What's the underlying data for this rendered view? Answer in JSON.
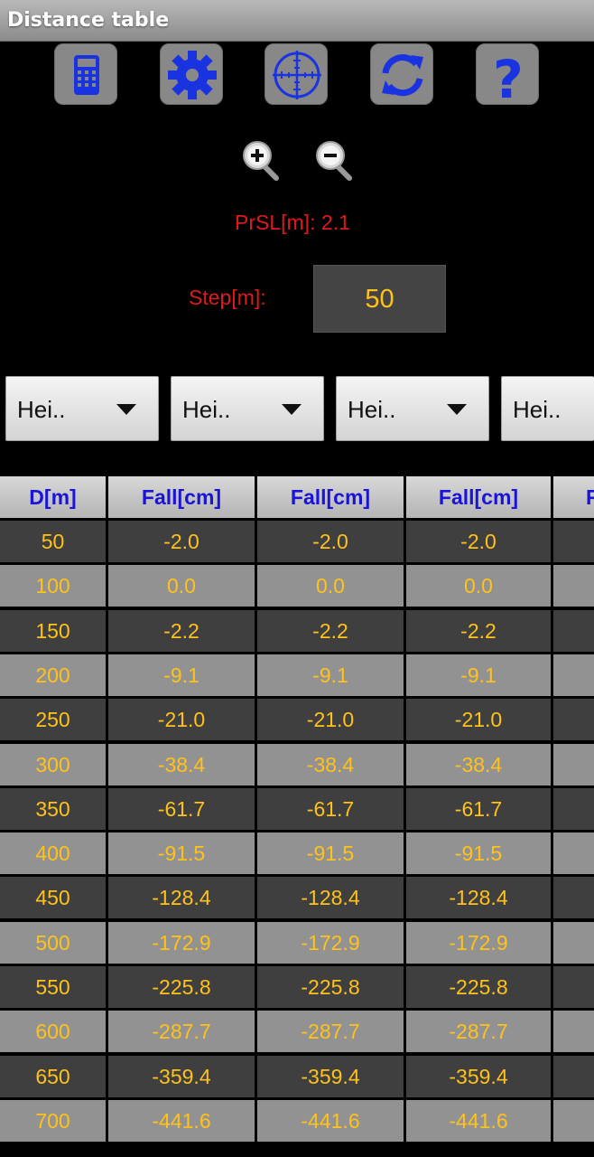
{
  "app": {
    "title": "Distance table"
  },
  "toolbar": [
    {
      "name": "calculator-icon"
    },
    {
      "name": "gear-icon"
    },
    {
      "name": "crosshair-icon"
    },
    {
      "name": "refresh-icon"
    },
    {
      "name": "help-icon",
      "glyph": "?"
    }
  ],
  "zoom": {
    "in_icon": "zoom-in-icon",
    "out_icon": "zoom-out-icon"
  },
  "info": {
    "prsl_label": "PrSL[m]: 2.1",
    "step_label": "Step[m]:",
    "step_value": "50"
  },
  "dropdowns": [
    {
      "label": "Hei.."
    },
    {
      "label": "Hei.."
    },
    {
      "label": "Hei.."
    },
    {
      "label": "Hei.."
    }
  ],
  "table": {
    "headers": [
      "D[m]",
      "Fall[cm]",
      "Fall[cm]",
      "Fall[cm]",
      "F"
    ],
    "rows": [
      [
        "50",
        "-2.0",
        "-2.0",
        "-2.0",
        ""
      ],
      [
        "100",
        "0.0",
        "0.0",
        "0.0",
        ""
      ],
      [
        "150",
        "-2.2",
        "-2.2",
        "-2.2",
        ""
      ],
      [
        "200",
        "-9.1",
        "-9.1",
        "-9.1",
        ""
      ],
      [
        "250",
        "-21.0",
        "-21.0",
        "-21.0",
        ""
      ],
      [
        "300",
        "-38.4",
        "-38.4",
        "-38.4",
        ""
      ],
      [
        "350",
        "-61.7",
        "-61.7",
        "-61.7",
        ""
      ],
      [
        "400",
        "-91.5",
        "-91.5",
        "-91.5",
        ""
      ],
      [
        "450",
        "-128.4",
        "-128.4",
        "-128.4",
        ""
      ],
      [
        "500",
        "-172.9",
        "-172.9",
        "-172.9",
        ""
      ],
      [
        "550",
        "-225.8",
        "-225.8",
        "-225.8",
        ""
      ],
      [
        "600",
        "-287.7",
        "-287.7",
        "-287.7",
        ""
      ],
      [
        "650",
        "-359.4",
        "-359.4",
        "-359.4",
        ""
      ],
      [
        "700",
        "-441.6",
        "-441.6",
        "-441.6",
        ""
      ]
    ]
  },
  "colors": {
    "title_text": "#ffffff",
    "icon_blue": "#1a33e0",
    "info_red": "#e01a1a",
    "value_gold": "#ffc21a",
    "header_text": "#1a14d8"
  }
}
